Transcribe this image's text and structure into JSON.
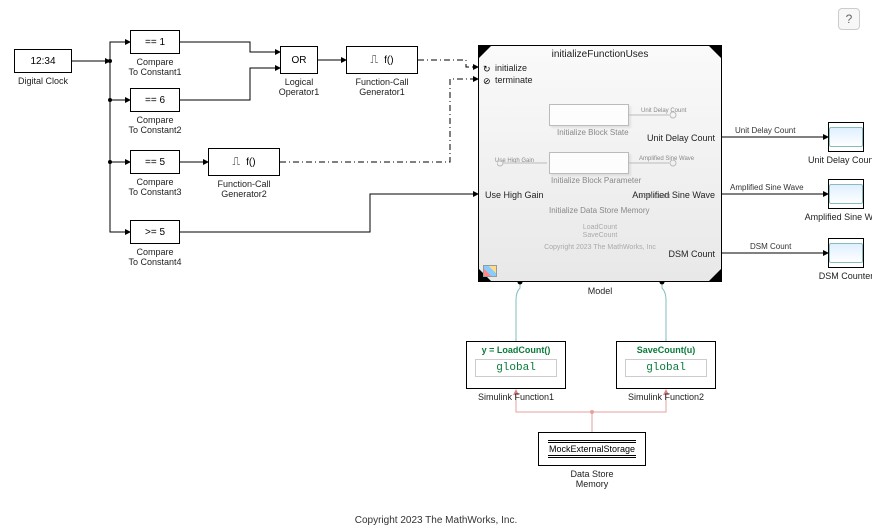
{
  "help_icon": "?",
  "digital_clock": {
    "value": "12:34",
    "label": "Digital Clock"
  },
  "compare1": {
    "text": "== 1",
    "label": "Compare\nTo Constant1"
  },
  "compare2": {
    "text": "== 6",
    "label": "Compare\nTo Constant2"
  },
  "compare3": {
    "text": "== 5",
    "label": "Compare\nTo Constant3"
  },
  "compare4": {
    "text": ">= 5",
    "label": "Compare\nTo Constant4"
  },
  "logic_or": {
    "text": "OR",
    "label": "Logical\nOperator1"
  },
  "fcngen1": {
    "text": "f()",
    "label": "Function-Call\nGenerator1"
  },
  "fcngen2": {
    "text": "f()",
    "label": "Function-Call\nGenerator2"
  },
  "model": {
    "title": "initializeFunctionUses",
    "port_init": "initialize",
    "port_term": "terminate",
    "port_gain_in": "Use High Gain",
    "port_amplified": "Amplified Sine Wave",
    "port_unit_delay": "Unit Delay Count",
    "port_dsm": "DSM Count",
    "label": "Model",
    "inner": {
      "box1_label": "Initialize Block State",
      "box1_sig": "Unit Delay Count",
      "box2_in": "Use High Gain",
      "box2_label": "Initialize Block Parameter",
      "box2_sig": "Amplified Sine Wave",
      "box3_label": "Initialize Data Store Memory",
      "box3_sig": "DSM Count",
      "foot1": "LoadCount",
      "foot2": "SaveCount",
      "copy": "Copyright 2023 The MathWorks, Inc"
    }
  },
  "signals": {
    "unit_delay": "Unit Delay Count",
    "amplified": "Amplified Sine   Wave",
    "dsm": "DSM Count"
  },
  "scope1": {
    "label": "Unit Delay Counter"
  },
  "scope2": {
    "label": "Amplified Sine Wave"
  },
  "scope3": {
    "label": "DSM Counter"
  },
  "simfn1": {
    "header": "y = LoadCount()",
    "body": "global",
    "label": "Simulink Function1"
  },
  "simfn2": {
    "header": "SaveCount(u)",
    "body": "global",
    "label": "Simulink Function2"
  },
  "dsm": {
    "text": "MockExternalStorage",
    "label": "Data Store\nMemory"
  },
  "copyright": "Copyright 2023 The MathWorks, Inc."
}
